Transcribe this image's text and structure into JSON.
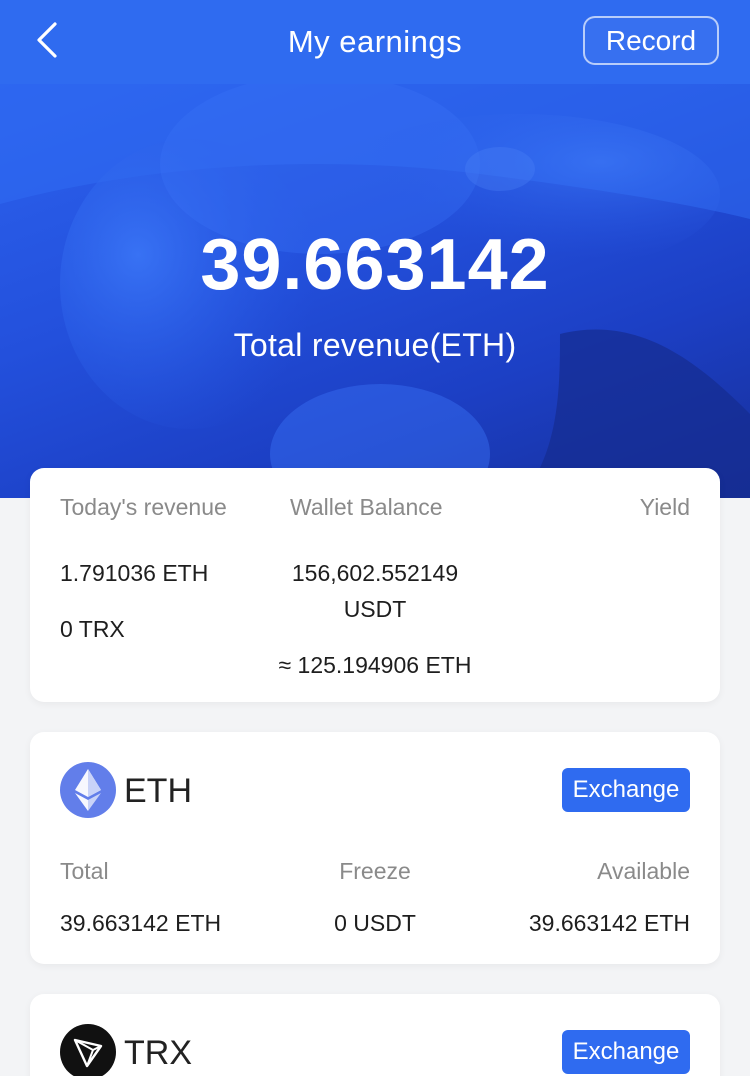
{
  "header": {
    "title": "My earnings",
    "record_label": "Record",
    "back_icon": "chevron-left-icon"
  },
  "hero": {
    "total_value": "39.663142",
    "total_label": "Total revenue(ETH)"
  },
  "summary": {
    "todays_revenue_label": "Today's revenue",
    "wallet_balance_label": "Wallet Balance",
    "yield_label": "Yield",
    "todays_revenue_eth": "1.791036 ETH",
    "todays_revenue_trx": "0 TRX",
    "wallet_balance_line1": "156,602.552149",
    "wallet_balance_line2": "USDT",
    "wallet_balance_approx": "≈ 125.194906 ETH"
  },
  "coins": [
    {
      "name": "ETH",
      "icon": "ethereum-icon",
      "exchange_label": "Exchange",
      "total_label": "Total",
      "freeze_label": "Freeze",
      "available_label": "Available",
      "total_value": "39.663142 ETH",
      "freeze_value": "0 USDT",
      "available_value": "39.663142 ETH"
    },
    {
      "name": "TRX",
      "icon": "tron-icon",
      "exchange_label": "Exchange"
    }
  ],
  "colors": {
    "accent": "#2f6bf0",
    "hero_dark": "#172f9a",
    "muted_text": "#8a8a8a",
    "background": "#f3f4f6"
  }
}
